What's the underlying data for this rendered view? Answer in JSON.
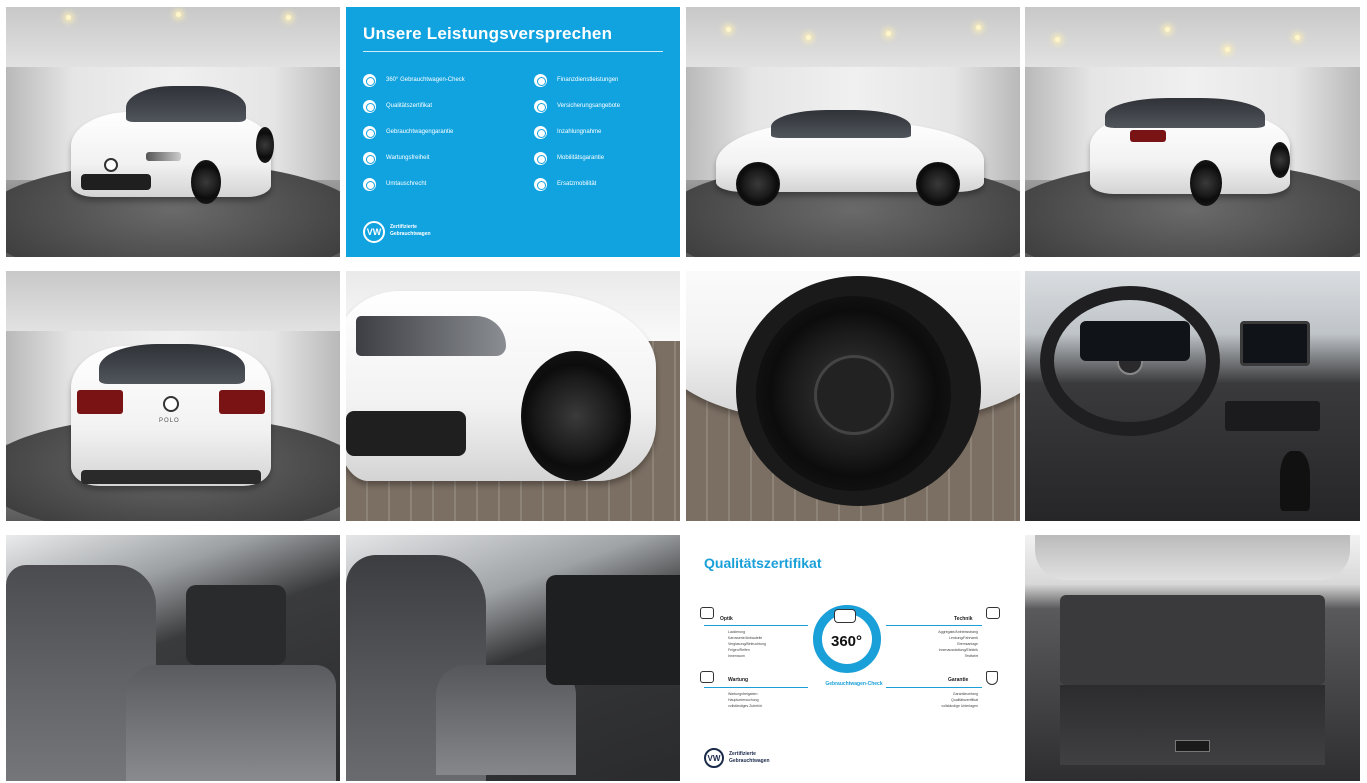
{
  "promise": {
    "title": "Unsere Leistungsversprechen",
    "left_items": [
      "360° Gebrauchtwagen-Check",
      "Qualitätszertifikat",
      "Gebrauchtwagengarantie",
      "Wartungsfreiheit",
      "Umtauschrecht"
    ],
    "right_items": [
      "Finanzdienstleistungen",
      "Versicherungsangebote",
      "Inzahlungnahme",
      "Mobilitätsgarantie",
      "Ersatzmobilität"
    ],
    "brand_line1": "Zertifizierte",
    "brand_line2": "Gebrauchtwagen"
  },
  "certificate": {
    "title": "Qualitätszertifikat",
    "left_sections": [
      {
        "label": "Optik",
        "items": [
          "Lackierung",
          "Karosserie/Anbauteile",
          "Verglasung/Beleuchtung",
          "Felgen/Reifen",
          "Innenraum"
        ]
      },
      {
        "label": "Wartung",
        "items": [
          "Wartungsfreigaben",
          "Hauptuntersuchung",
          "vollständiges Zubehör"
        ]
      }
    ],
    "right_sections": [
      {
        "label": "Technik",
        "items": [
          "Aggregate/Antriebsstrang",
          "Lenkung/Fahrwerk",
          "Bremsanlage",
          "Innenausstattung/Elektrik",
          "Testfahrt"
        ]
      },
      {
        "label": "Garantie",
        "items": [
          "Garantieumfang",
          "Qualitätszertifikat",
          "vollständige Unterlagen"
        ]
      }
    ],
    "badge_number": "360°",
    "badge_text": "Gebrauchtwagen-Check",
    "brand_line1": "Zertifizierte",
    "brand_line2": "Gebrauchtwagen"
  },
  "car": {
    "model_badge": "POLO",
    "color": "#ffffff"
  },
  "colors": {
    "brand_blue": "#10a3e0",
    "cert_blue": "#1aa0d8"
  }
}
